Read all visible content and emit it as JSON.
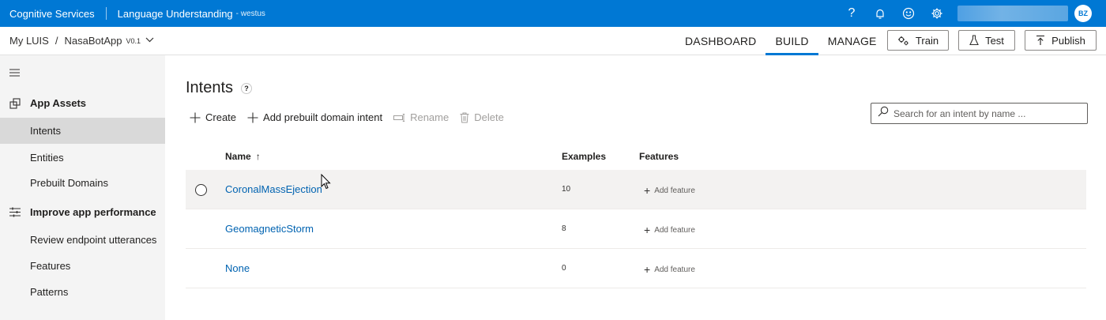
{
  "topbar": {
    "brand": "Cognitive Services",
    "product": "Language Understanding",
    "region": "- westus",
    "avatar_initials": "BZ",
    "icons": [
      "help-icon",
      "notification-icon",
      "feedback-smiley-icon",
      "settings-gear-icon"
    ]
  },
  "breadcrumb": {
    "root": "My LUIS",
    "separator": "/",
    "app": "NasaBotApp",
    "version": "V0.1"
  },
  "nav": {
    "tabs": [
      {
        "label": "DASHBOARD",
        "active": false
      },
      {
        "label": "BUILD",
        "active": true
      },
      {
        "label": "MANAGE",
        "active": false
      }
    ],
    "accent": "#0078d4"
  },
  "actions": {
    "train": "Train",
    "test": "Test",
    "publish": "Publish"
  },
  "sidebar": {
    "group_assets": "App Assets",
    "items_assets": [
      "Intents",
      "Entities",
      "Prebuilt Domains"
    ],
    "group_improve": "Improve app performance",
    "items_improve": [
      "Review endpoint utterances",
      "Features",
      "Patterns"
    ],
    "active_item": "Intents"
  },
  "main": {
    "title": "Intents",
    "help": "?",
    "commands": {
      "create": "Create",
      "add_prebuilt": "Add prebuilt domain intent",
      "rename": "Rename",
      "delete": "Delete"
    },
    "search_placeholder": "Search for an intent by name ..."
  },
  "table": {
    "columns": {
      "name": "Name",
      "sort_arrow": "↑",
      "examples": "Examples",
      "features": "Features"
    },
    "rows": [
      {
        "name": "CoronalMassEjection",
        "examples": "10",
        "features": "Add feature"
      },
      {
        "name": "GeomagneticStorm",
        "examples": "8",
        "features": "Add feature"
      },
      {
        "name": "None",
        "examples": "0",
        "features": "Add feature"
      }
    ]
  }
}
